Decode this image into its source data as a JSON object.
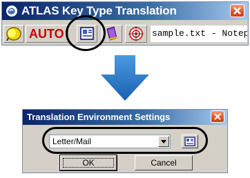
{
  "atlas_window": {
    "title": "ATLAS Key Type Translation",
    "auto_label": "AUTO",
    "target_app": "sample.txt - Notepad",
    "icons": [
      "atlas-logo-icon",
      "translate-key-icon",
      "env-settings-icon",
      "dictionary-icon",
      "target-icon",
      "close-icon"
    ]
  },
  "dialog": {
    "title": "Translation Environment Settings",
    "selected_environment": "Letter/Mail",
    "ok_label": "OK",
    "cancel_label": "Cancel"
  },
  "colors": {
    "title_bar": "#0a246a",
    "close_button": "#e05a2c",
    "arrow": "#2878c8",
    "auto_text": "#cc0000"
  }
}
